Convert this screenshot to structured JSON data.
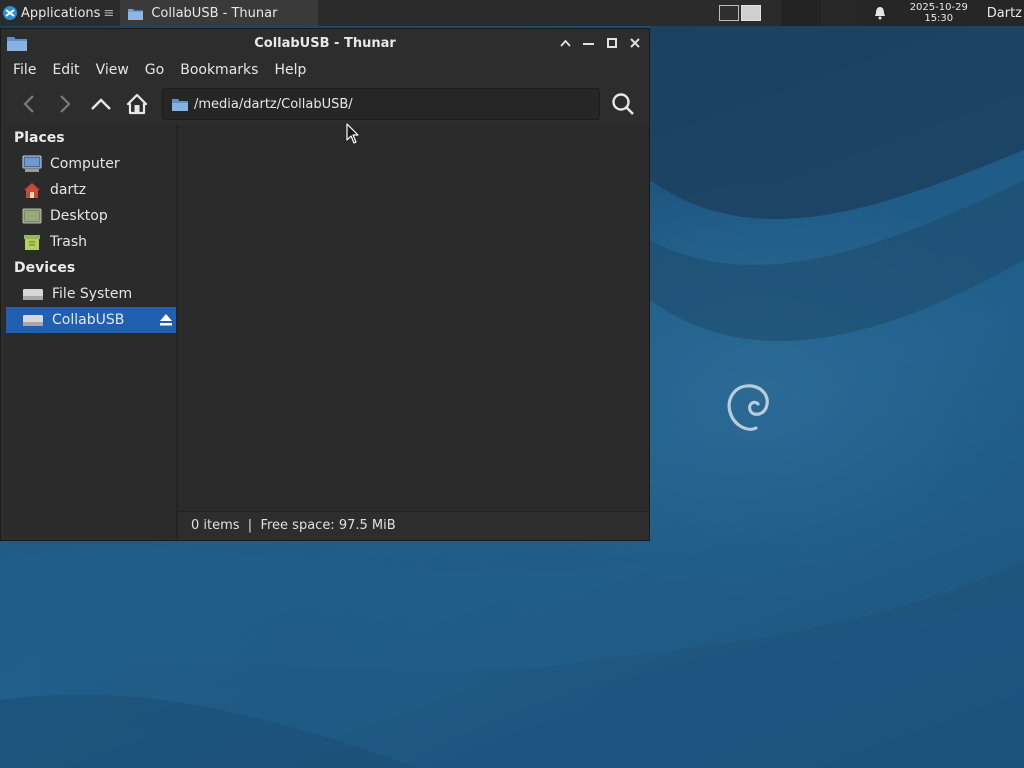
{
  "panel": {
    "applications_label": "Applications",
    "task_label": "CollabUSB - Thunar",
    "clock_date": "2025-10-29",
    "clock_time": "15:30",
    "user_name": "Dartz"
  },
  "window": {
    "title": "CollabUSB - Thunar",
    "menu": [
      "File",
      "Edit",
      "View",
      "Go",
      "Bookmarks",
      "Help"
    ],
    "location_path": "/media/dartz/CollabUSB/"
  },
  "sidebar": {
    "places_heading": "Places",
    "places": [
      {
        "label": "Computer",
        "icon": "computer-icon"
      },
      {
        "label": "dartz",
        "icon": "home-folder-icon"
      },
      {
        "label": "Desktop",
        "icon": "desktop-icon"
      },
      {
        "label": "Trash",
        "icon": "trash-icon"
      }
    ],
    "devices_heading": "Devices",
    "devices": [
      {
        "label": "File System",
        "icon": "drive-icon"
      },
      {
        "label": "CollabUSB",
        "icon": "usb-drive-icon",
        "selected": true
      }
    ]
  },
  "status": {
    "text": "0 items  |  Free space: 97.5 MiB"
  },
  "colors": {
    "selection": "#2160b0",
    "window_bg": "#2d2d2d",
    "panel_bg": "#2b2b2b",
    "desktop": "#1f5b86"
  }
}
